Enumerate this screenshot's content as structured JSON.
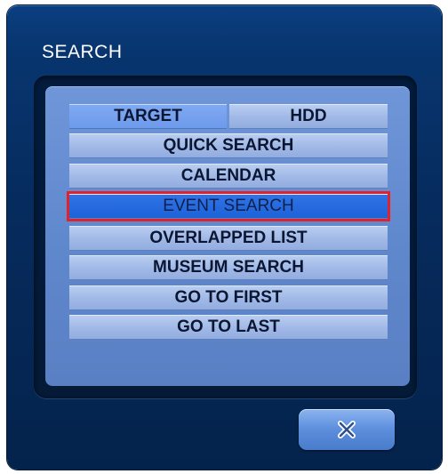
{
  "dialog": {
    "title": "SEARCH"
  },
  "target_row": {
    "label": "TARGET",
    "value": "HDD"
  },
  "menu": {
    "items": [
      {
        "label": "QUICK SEARCH"
      },
      {
        "label": "CALENDAR"
      },
      {
        "label": "EVENT SEARCH",
        "selected": true
      },
      {
        "label": "OVERLAPPED LIST"
      },
      {
        "label": "MUSEUM SEARCH"
      },
      {
        "label": "GO TO FIRST"
      },
      {
        "label": "GO TO LAST"
      }
    ]
  },
  "footer": {
    "close_icon": "close-icon"
  },
  "colors": {
    "selection_outline": "#e2222a",
    "selected_fill": "#1e62da",
    "panel_fill": "#6f96d8",
    "dialog_fill": "#062b5d"
  }
}
